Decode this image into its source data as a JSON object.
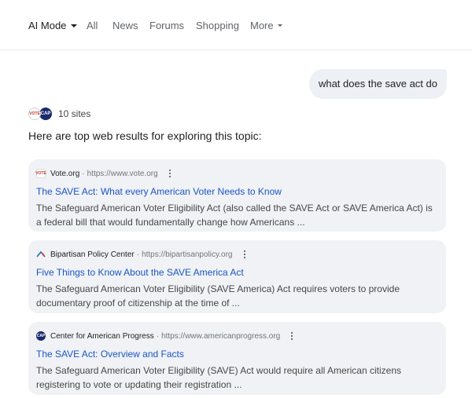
{
  "tabs": [
    {
      "label": "AI Mode",
      "active": true
    },
    {
      "label": "All"
    },
    {
      "label": "News"
    },
    {
      "label": "Forums"
    },
    {
      "label": "Shopping"
    },
    {
      "label": "More"
    }
  ],
  "query": "what does the save act do",
  "sources": {
    "count_label": "10 sites",
    "icons": [
      "vote-org-logo",
      "cap-logo"
    ]
  },
  "intro": "Here are top web results for exploring this topic:",
  "results": [
    {
      "site": "Vote.org",
      "url": "https://www.vote.org",
      "favicon": "vote-org-favicon",
      "title": "The SAVE Act: What every American Voter Needs to Know",
      "snippet": "The Safeguard American Voter Eligibility Act (also called the SAVE Act or SAVE America Act) is a federal bill that would fundamentally change how Americans ..."
    },
    {
      "site": "Bipartisan Policy Center",
      "url": "https://bipartisanpolicy.org",
      "favicon": "bipartisan-policy-center-favicon",
      "title": "Five Things to Know About the SAVE America Act",
      "snippet": "The Safeguard American Voter Eligibility (SAVE America) Act requires voters to provide documentary proof of citizenship at the time of ..."
    },
    {
      "site": "Center for American Progress",
      "url": "https://www.americanprogress.org",
      "favicon": "cap-favicon",
      "title": "The SAVE Act: Overview and Facts",
      "snippet": "The Safeguard American Voter Eligibility (SAVE) Act would require all American citizens registering to vote or updating their registration ..."
    }
  ],
  "colors": {
    "link": "#1a55c8",
    "card_bg": "#f0f2f5",
    "bubble_bg": "#edf1f6"
  }
}
